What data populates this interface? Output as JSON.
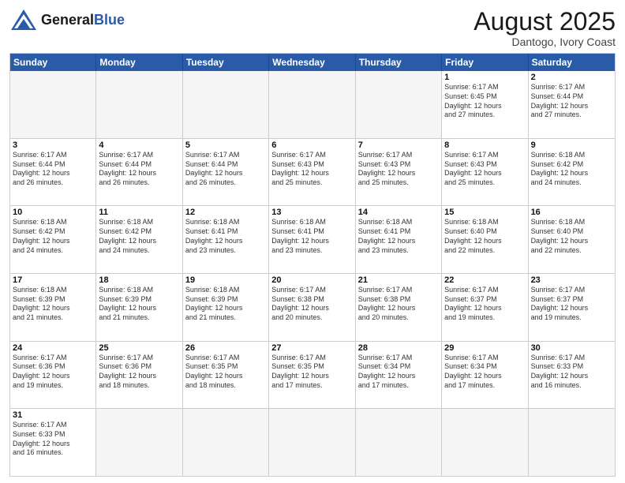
{
  "header": {
    "logo_general": "General",
    "logo_blue": "Blue",
    "title": "August 2025",
    "subtitle": "Dantogo, Ivory Coast"
  },
  "days_of_week": [
    "Sunday",
    "Monday",
    "Tuesday",
    "Wednesday",
    "Thursday",
    "Friday",
    "Saturday"
  ],
  "weeks": [
    [
      {
        "day": "",
        "text": ""
      },
      {
        "day": "",
        "text": ""
      },
      {
        "day": "",
        "text": ""
      },
      {
        "day": "",
        "text": ""
      },
      {
        "day": "",
        "text": ""
      },
      {
        "day": "1",
        "text": "Sunrise: 6:17 AM\nSunset: 6:45 PM\nDaylight: 12 hours\nand 27 minutes."
      },
      {
        "day": "2",
        "text": "Sunrise: 6:17 AM\nSunset: 6:44 PM\nDaylight: 12 hours\nand 27 minutes."
      }
    ],
    [
      {
        "day": "3",
        "text": "Sunrise: 6:17 AM\nSunset: 6:44 PM\nDaylight: 12 hours\nand 26 minutes."
      },
      {
        "day": "4",
        "text": "Sunrise: 6:17 AM\nSunset: 6:44 PM\nDaylight: 12 hours\nand 26 minutes."
      },
      {
        "day": "5",
        "text": "Sunrise: 6:17 AM\nSunset: 6:44 PM\nDaylight: 12 hours\nand 26 minutes."
      },
      {
        "day": "6",
        "text": "Sunrise: 6:17 AM\nSunset: 6:43 PM\nDaylight: 12 hours\nand 25 minutes."
      },
      {
        "day": "7",
        "text": "Sunrise: 6:17 AM\nSunset: 6:43 PM\nDaylight: 12 hours\nand 25 minutes."
      },
      {
        "day": "8",
        "text": "Sunrise: 6:17 AM\nSunset: 6:43 PM\nDaylight: 12 hours\nand 25 minutes."
      },
      {
        "day": "9",
        "text": "Sunrise: 6:18 AM\nSunset: 6:42 PM\nDaylight: 12 hours\nand 24 minutes."
      }
    ],
    [
      {
        "day": "10",
        "text": "Sunrise: 6:18 AM\nSunset: 6:42 PM\nDaylight: 12 hours\nand 24 minutes."
      },
      {
        "day": "11",
        "text": "Sunrise: 6:18 AM\nSunset: 6:42 PM\nDaylight: 12 hours\nand 24 minutes."
      },
      {
        "day": "12",
        "text": "Sunrise: 6:18 AM\nSunset: 6:41 PM\nDaylight: 12 hours\nand 23 minutes."
      },
      {
        "day": "13",
        "text": "Sunrise: 6:18 AM\nSunset: 6:41 PM\nDaylight: 12 hours\nand 23 minutes."
      },
      {
        "day": "14",
        "text": "Sunrise: 6:18 AM\nSunset: 6:41 PM\nDaylight: 12 hours\nand 23 minutes."
      },
      {
        "day": "15",
        "text": "Sunrise: 6:18 AM\nSunset: 6:40 PM\nDaylight: 12 hours\nand 22 minutes."
      },
      {
        "day": "16",
        "text": "Sunrise: 6:18 AM\nSunset: 6:40 PM\nDaylight: 12 hours\nand 22 minutes."
      }
    ],
    [
      {
        "day": "17",
        "text": "Sunrise: 6:18 AM\nSunset: 6:39 PM\nDaylight: 12 hours\nand 21 minutes."
      },
      {
        "day": "18",
        "text": "Sunrise: 6:18 AM\nSunset: 6:39 PM\nDaylight: 12 hours\nand 21 minutes."
      },
      {
        "day": "19",
        "text": "Sunrise: 6:18 AM\nSunset: 6:39 PM\nDaylight: 12 hours\nand 21 minutes."
      },
      {
        "day": "20",
        "text": "Sunrise: 6:17 AM\nSunset: 6:38 PM\nDaylight: 12 hours\nand 20 minutes."
      },
      {
        "day": "21",
        "text": "Sunrise: 6:17 AM\nSunset: 6:38 PM\nDaylight: 12 hours\nand 20 minutes."
      },
      {
        "day": "22",
        "text": "Sunrise: 6:17 AM\nSunset: 6:37 PM\nDaylight: 12 hours\nand 19 minutes."
      },
      {
        "day": "23",
        "text": "Sunrise: 6:17 AM\nSunset: 6:37 PM\nDaylight: 12 hours\nand 19 minutes."
      }
    ],
    [
      {
        "day": "24",
        "text": "Sunrise: 6:17 AM\nSunset: 6:36 PM\nDaylight: 12 hours\nand 19 minutes."
      },
      {
        "day": "25",
        "text": "Sunrise: 6:17 AM\nSunset: 6:36 PM\nDaylight: 12 hours\nand 18 minutes."
      },
      {
        "day": "26",
        "text": "Sunrise: 6:17 AM\nSunset: 6:35 PM\nDaylight: 12 hours\nand 18 minutes."
      },
      {
        "day": "27",
        "text": "Sunrise: 6:17 AM\nSunset: 6:35 PM\nDaylight: 12 hours\nand 17 minutes."
      },
      {
        "day": "28",
        "text": "Sunrise: 6:17 AM\nSunset: 6:34 PM\nDaylight: 12 hours\nand 17 minutes."
      },
      {
        "day": "29",
        "text": "Sunrise: 6:17 AM\nSunset: 6:34 PM\nDaylight: 12 hours\nand 17 minutes."
      },
      {
        "day": "30",
        "text": "Sunrise: 6:17 AM\nSunset: 6:33 PM\nDaylight: 12 hours\nand 16 minutes."
      }
    ],
    [
      {
        "day": "31",
        "text": "Sunrise: 6:17 AM\nSunset: 6:33 PM\nDaylight: 12 hours\nand 16 minutes."
      },
      {
        "day": "",
        "text": ""
      },
      {
        "day": "",
        "text": ""
      },
      {
        "day": "",
        "text": ""
      },
      {
        "day": "",
        "text": ""
      },
      {
        "day": "",
        "text": ""
      },
      {
        "day": "",
        "text": ""
      }
    ]
  ]
}
